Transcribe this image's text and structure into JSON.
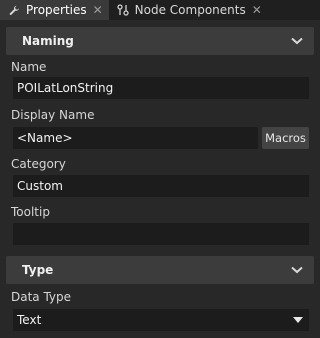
{
  "tabs": [
    {
      "label": "Properties",
      "close": "✕"
    },
    {
      "label": "Node Components",
      "close": "✕"
    }
  ],
  "sections": {
    "naming": {
      "title": "Naming"
    },
    "type": {
      "title": "Type"
    }
  },
  "fields": {
    "name": {
      "label": "Name",
      "value": "POILatLonString"
    },
    "display_name": {
      "label": "Display Name",
      "value": "<Name>",
      "button": "Macros"
    },
    "category": {
      "label": "Category",
      "value": "Custom"
    },
    "tooltip": {
      "label": "Tooltip",
      "value": ""
    },
    "data_type": {
      "label": "Data Type",
      "value": "Text"
    }
  },
  "icons": {
    "properties_tab": "wrench-icon",
    "node_components_tab": "node-components-icon",
    "collapse": "chevron-down-icon",
    "dropdown": "caret-down-icon"
  }
}
